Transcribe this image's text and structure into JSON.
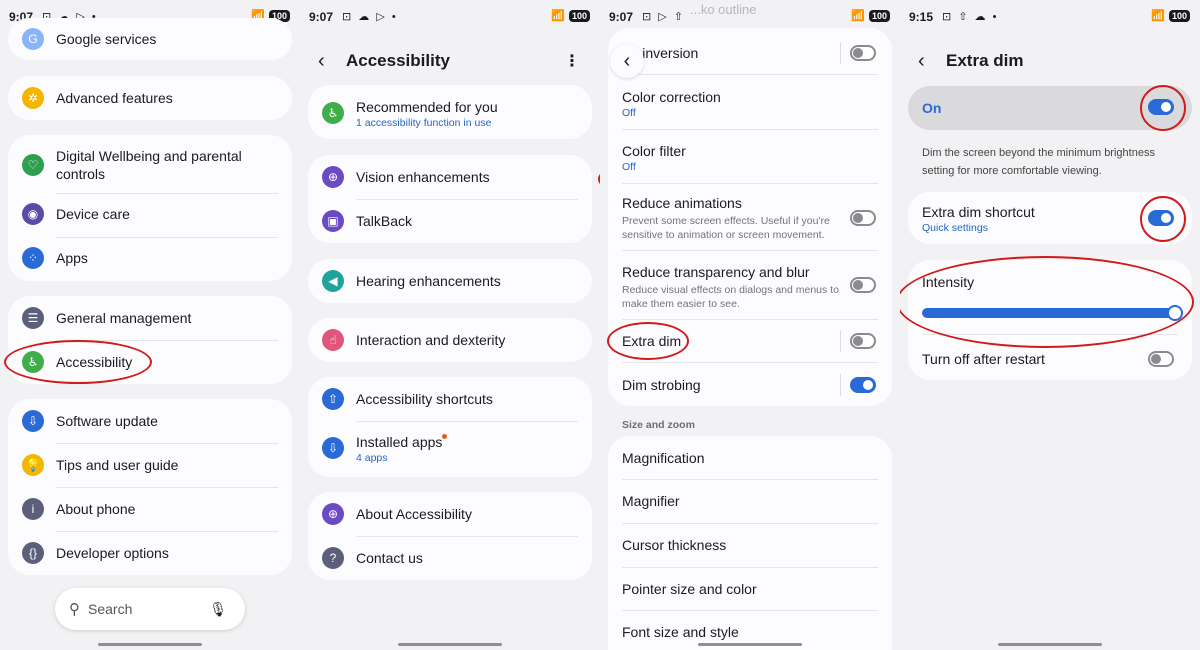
{
  "colors": {
    "accent": "#2a6ad7",
    "annotation_ring": "#d11a1a",
    "background": "#f2f2f4",
    "card": "#fcfcfe"
  },
  "panel1": {
    "status": {
      "time": "9:07",
      "left_icons": "⊡ ☁ ▷ •",
      "battery": "100"
    },
    "items": [
      {
        "label": "Google services",
        "icon": "google-icon",
        "color": "#8ab4f8"
      },
      {
        "label": "Advanced features",
        "icon": "gear-star-icon",
        "color": "#f4b400"
      },
      {
        "label": "Digital Wellbeing and parental controls",
        "icon": "heart-icon",
        "color": "#2e9f4e"
      },
      {
        "label": "Device care",
        "icon": "device-care-icon",
        "color": "#5b4aa8"
      },
      {
        "label": "Apps",
        "icon": "apps-icon",
        "color": "#2a6ad7"
      },
      {
        "label": "General management",
        "icon": "sliders-icon",
        "color": "#5c5f7a"
      },
      {
        "label": "Accessibility",
        "icon": "accessibility-icon",
        "color": "#3fae4a"
      },
      {
        "label": "Software update",
        "icon": "update-icon",
        "color": "#2a6ad7"
      },
      {
        "label": "Tips and user guide",
        "icon": "lightbulb-icon",
        "color": "#f2b705"
      },
      {
        "label": "About phone",
        "icon": "info-icon",
        "color": "#5c5f7a"
      },
      {
        "label": "Developer options",
        "icon": "braces-icon",
        "color": "#5c5f7a"
      }
    ],
    "search": {
      "placeholder": "Search"
    }
  },
  "panel2": {
    "status": {
      "time": "9:07",
      "left_icons": "⊡ ☁ ▷ •",
      "battery": "100"
    },
    "title": "Accessibility",
    "items": [
      {
        "label": "Recommended for you",
        "sub": "1 accessibility function in use",
        "color": "#3fae4a"
      },
      {
        "label": "Vision enhancements",
        "color": "#6a4bc4"
      },
      {
        "label": "TalkBack",
        "color": "#6a4bc4"
      },
      {
        "label": "Hearing enhancements",
        "color": "#1fa39a"
      },
      {
        "label": "Interaction and dexterity",
        "color": "#e0557a"
      },
      {
        "label": "Accessibility shortcuts",
        "color": "#2a6ad7"
      },
      {
        "label": "Installed apps",
        "sub": "4 apps",
        "color": "#2a6ad7"
      },
      {
        "label": "About Accessibility",
        "color": "#6a4bc4"
      },
      {
        "label": "Contact us",
        "color": "#5c5f7a"
      }
    ]
  },
  "panel3": {
    "status": {
      "time": "9:07",
      "left_icons": "⊡ ▷ ⇧",
      "battery": "100"
    },
    "top_partial": "...ko outline",
    "items": [
      {
        "label": "...r inversion",
        "toggle": false
      },
      {
        "label": "Color correction",
        "sub": "Off"
      },
      {
        "label": "Color filter",
        "sub": "Off"
      },
      {
        "label": "Reduce animations",
        "desc": "Prevent some screen effects. Useful if you're sensitive to animation or screen movement.",
        "toggle": false
      },
      {
        "label": "Reduce transparency and blur",
        "desc": "Reduce visual effects on dialogs and menus to make them easier to see.",
        "toggle": false
      },
      {
        "label": "Extra dim",
        "toggle": false
      },
      {
        "label": "Dim strobing",
        "toggle": true
      }
    ],
    "section": "Size and zoom",
    "zoom_items": [
      "Magnification",
      "Magnifier",
      "Cursor thickness",
      "Pointer size and color",
      "Font size and style"
    ]
  },
  "panel4": {
    "status": {
      "time": "9:15",
      "left_icons": "⊡ ⇧ ☁ •",
      "battery": "100"
    },
    "title": "Extra dim",
    "on_label": "On",
    "on_toggle": true,
    "explanation": "Dim the screen beyond the minimum brightness setting for more comfortable viewing.",
    "shortcut": {
      "label": "Extra dim shortcut",
      "sub": "Quick settings",
      "toggle": true
    },
    "intensity": {
      "label": "Intensity",
      "value": 1.0
    },
    "restart": {
      "label": "Turn off after restart",
      "toggle": false
    }
  }
}
